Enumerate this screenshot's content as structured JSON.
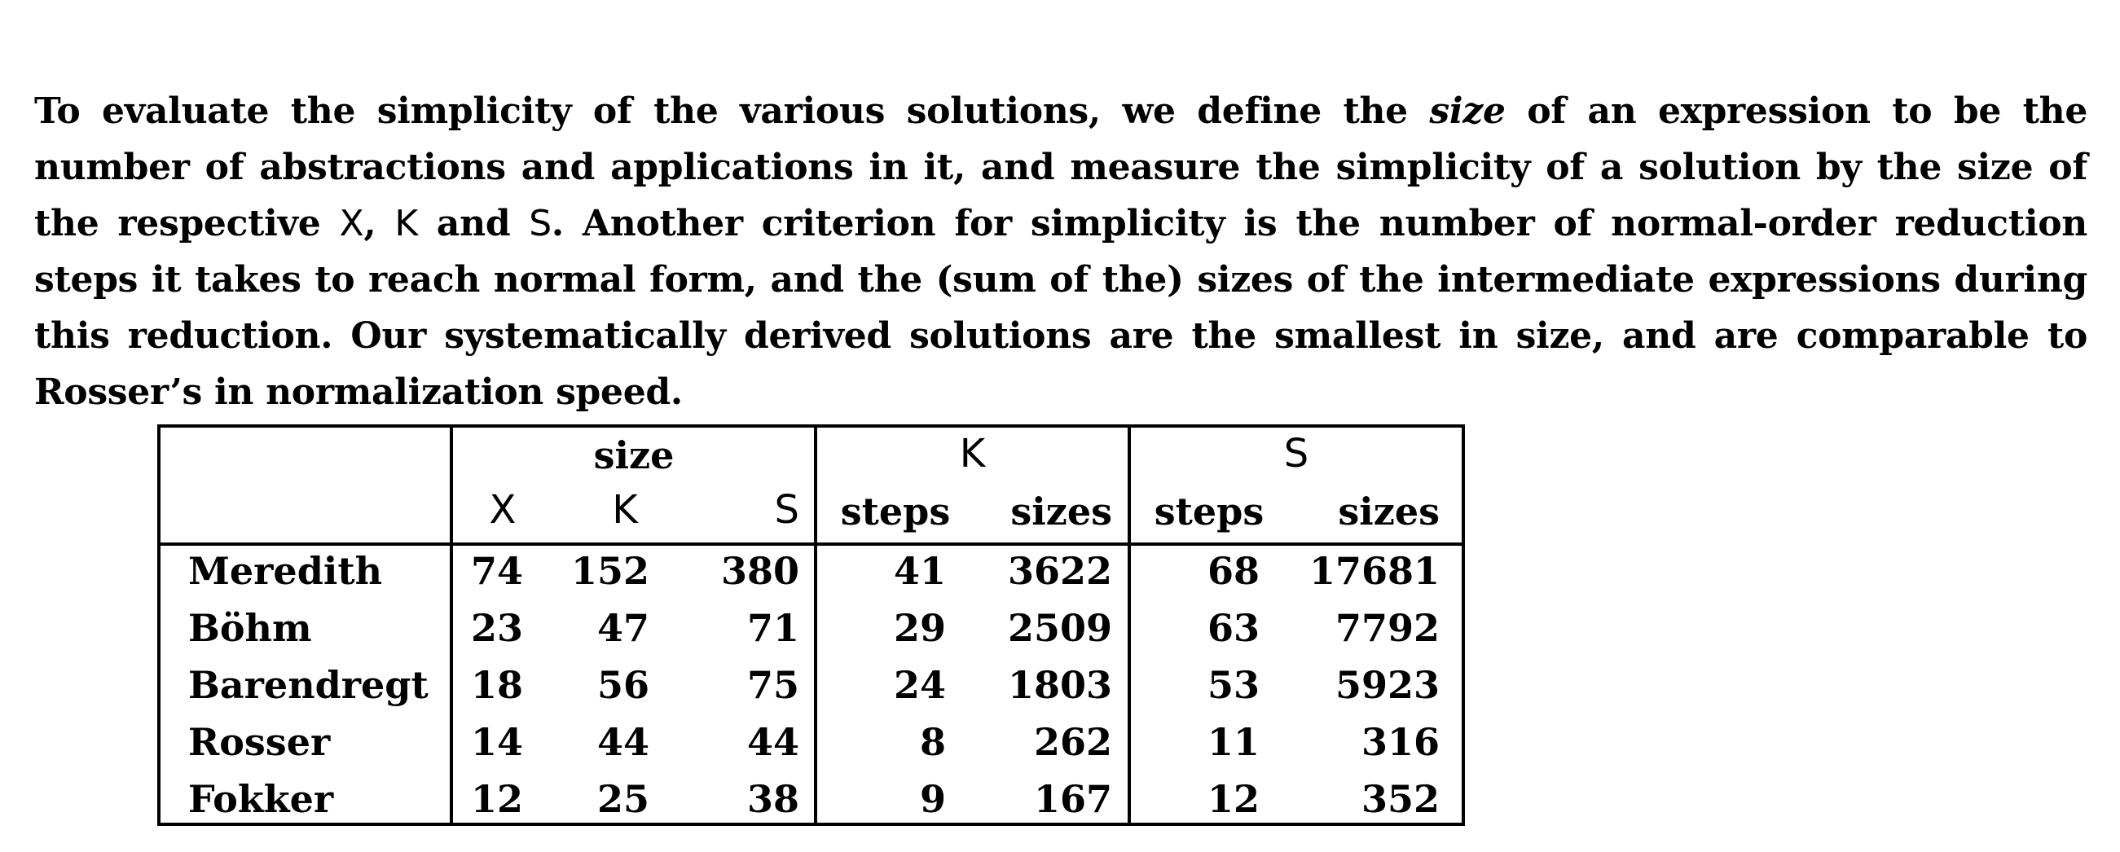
{
  "paragraph": {
    "part1": "To evaluate the simplicity of the various solutions, we define the ",
    "emph": "size",
    "part2": " of an expression to be the number of abstractions and applications in it, and measure the simplicity of a solution by the size of the respective ",
    "x": "X",
    "comma": ", ",
    "k": "K",
    "and": " and ",
    "s": "S",
    "part3": ".  Another criterion for simplicity is the number of normal-order reduction steps it takes to reach normal form, and the (sum of the) sizes of the intermediate expressions during this reduction.  Our systematically derived solutions are the smallest in size, and are comparable to Rosser’s in normalization speed."
  },
  "table": {
    "group_headers": {
      "size": "size",
      "k": "K",
      "s": "S"
    },
    "sub_headers": {
      "x": "X",
      "k": "K",
      "s": "S",
      "k_steps": "steps",
      "k_sizes": "sizes",
      "s_steps": "steps",
      "s_sizes": "sizes"
    },
    "rows": [
      {
        "name": "Meredith",
        "x": "74",
        "k": "152",
        "s": "380",
        "k_steps": "41",
        "k_sizes": "3622",
        "s_steps": "68",
        "s_sizes": "17681"
      },
      {
        "name": "Böhm",
        "x": "23",
        "k": "47",
        "s": "71",
        "k_steps": "29",
        "k_sizes": "2509",
        "s_steps": "63",
        "s_sizes": "7792"
      },
      {
        "name": "Barendregt",
        "x": "18",
        "k": "56",
        "s": "75",
        "k_steps": "24",
        "k_sizes": "1803",
        "s_steps": "53",
        "s_sizes": "5923"
      },
      {
        "name": "Rosser",
        "x": "14",
        "k": "44",
        "s": "44",
        "k_steps": "8",
        "k_sizes": "262",
        "s_steps": "11",
        "s_sizes": "316"
      },
      {
        "name": "Fokker",
        "x": "12",
        "k": "25",
        "s": "38",
        "k_steps": "9",
        "k_sizes": "167",
        "s_steps": "12",
        "s_sizes": "352"
      }
    ]
  }
}
